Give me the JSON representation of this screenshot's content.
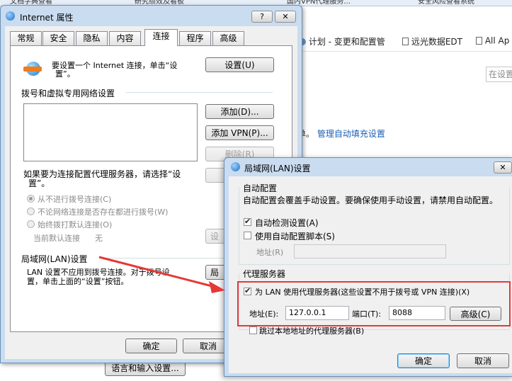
{
  "browser": {
    "tabs": [
      "文档字典查看",
      "研究绩效及看板",
      "国内VPN代理服务...",
      "安全风险查看系统"
    ],
    "bookmarks": [
      "计划 - 变更和配置管",
      "远光数据EDT",
      "All Ap"
    ],
    "search_placeholder": "在设置",
    "autofill_prefix": "单。",
    "autofill_link": "管理自动填充设置",
    "bottom_button": "语言和输入设置..."
  },
  "internet_props": {
    "title": "Internet 属性",
    "tabs": [
      "常规",
      "安全",
      "隐私",
      "内容",
      "连接",
      "程序",
      "高级"
    ],
    "setup_text_line1": "要设置一个 Internet 连接，单击“设",
    "setup_text_line2": "置”。",
    "setup_button": "设置(U)",
    "dial_section_label": "拨号和虚拟专用网络设置",
    "add_button": "添加(D)...",
    "add_vpn_button": "添加 VPN(P)...",
    "delete_button": "删除(R)",
    "proxy_hint_line1": "如果要为连接配置代理服务器，请选择“设",
    "proxy_hint_line2": "置”。",
    "radio_options": [
      "从不进行拨号连接(C)",
      "不论网络连接是否存在都进行拨号(W)",
      "始终拨打默认连接(O)"
    ],
    "current_default_label": "当前默认连接",
    "current_default_value": "无",
    "settings_partial": "设",
    "lan_section_label": "局域网(LAN)设置",
    "lan_text_line1": "LAN 设置不应用到拨号连接。对于拨号设",
    "lan_text_line2": "置，单击上面的“设置”按钮。",
    "lan_button_partial": "局",
    "ok_button": "确定",
    "cancel_button": "取消",
    "help_icon": "?",
    "close_icon": "✕"
  },
  "lan_dialog": {
    "title": "局域网(LAN)设置",
    "auto_config_label": "自动配置",
    "auto_config_desc": "自动配置会覆盖手动设置。要确保使用手动设置，请禁用自动配置。",
    "auto_detect_label": "自动检测设置(A)",
    "auto_detect_checked": true,
    "use_script_label": "使用自动配置脚本(S)",
    "use_script_checked": false,
    "script_address_label": "地址(R)",
    "script_address_value": "",
    "proxy_section_label": "代理服务器",
    "use_proxy_label": "为 LAN 使用代理服务器(这些设置不用于拨号或 VPN 连接)(X)",
    "use_proxy_checked": true,
    "address_label": "地址(E):",
    "address_value": "127.0.0.1",
    "port_label": "端口(T):",
    "port_value": "8088",
    "advanced_button": "高级(C)",
    "bypass_local_label": "跳过本地地址的代理服务器(B)",
    "bypass_local_checked": false,
    "ok_button": "确定",
    "cancel_button": "取消"
  },
  "colors": {
    "highlight_box": "#e23a3a",
    "arrow": "#e53935",
    "link": "#1a5fb4",
    "dialog_bg": "#f0f0f0",
    "aero_frame": "#c9dcf0"
  }
}
